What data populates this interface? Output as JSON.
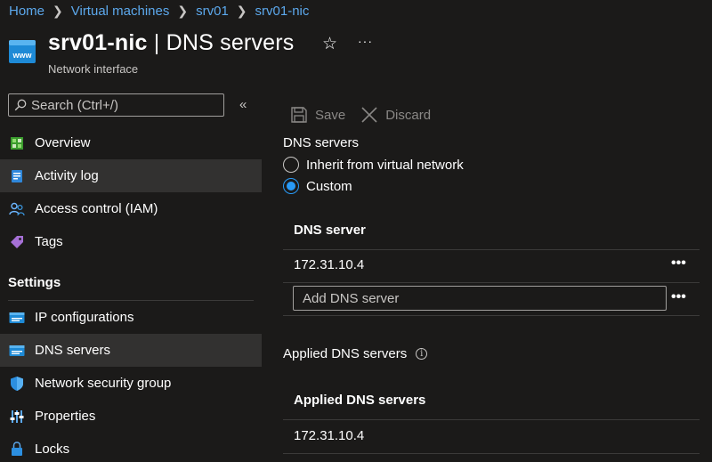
{
  "breadcrumb": [
    "Home",
    "Virtual machines",
    "srv01",
    "srv01-nic"
  ],
  "header": {
    "resource_name": "srv01-nic",
    "separator": " | ",
    "page_name": "DNS servers",
    "subtitle": "Network interface",
    "favorite_icon": "star-icon",
    "more_label": "···"
  },
  "sidebar": {
    "search_placeholder": "Search (Ctrl+/)",
    "collapse_label": "«",
    "items_top": [
      {
        "label": "Overview",
        "icon": "overview-icon"
      },
      {
        "label": "Activity log",
        "icon": "activity-log-icon"
      },
      {
        "label": "Access control (IAM)",
        "icon": "people-icon"
      },
      {
        "label": "Tags",
        "icon": "tag-icon"
      }
    ],
    "settings_title": "Settings",
    "items_settings": [
      {
        "label": "IP configurations",
        "icon": "ip-config-icon"
      },
      {
        "label": "DNS servers",
        "icon": "dns-icon",
        "selected": true
      },
      {
        "label": "Network security group",
        "icon": "shield-icon"
      },
      {
        "label": "Properties",
        "icon": "properties-icon"
      },
      {
        "label": "Locks",
        "icon": "lock-icon"
      }
    ]
  },
  "toolbar": {
    "save_label": "Save",
    "discard_label": "Discard"
  },
  "dns": {
    "field_label": "DNS servers",
    "options": [
      "Inherit from virtual network",
      "Custom"
    ],
    "selected_option": "Custom",
    "grid_header": "DNS server",
    "servers": [
      "172.31.10.4"
    ],
    "add_placeholder": "Add DNS server",
    "row_menu_label": "•••"
  },
  "applied": {
    "label": "Applied DNS servers",
    "info_label": "i",
    "grid_header": "Applied DNS servers",
    "servers": [
      "172.31.10.4"
    ]
  },
  "colors": {
    "background": "#1b1a19",
    "link": "#5ca8ec",
    "accent": "#2899f5",
    "selected_nav": "#323130"
  }
}
